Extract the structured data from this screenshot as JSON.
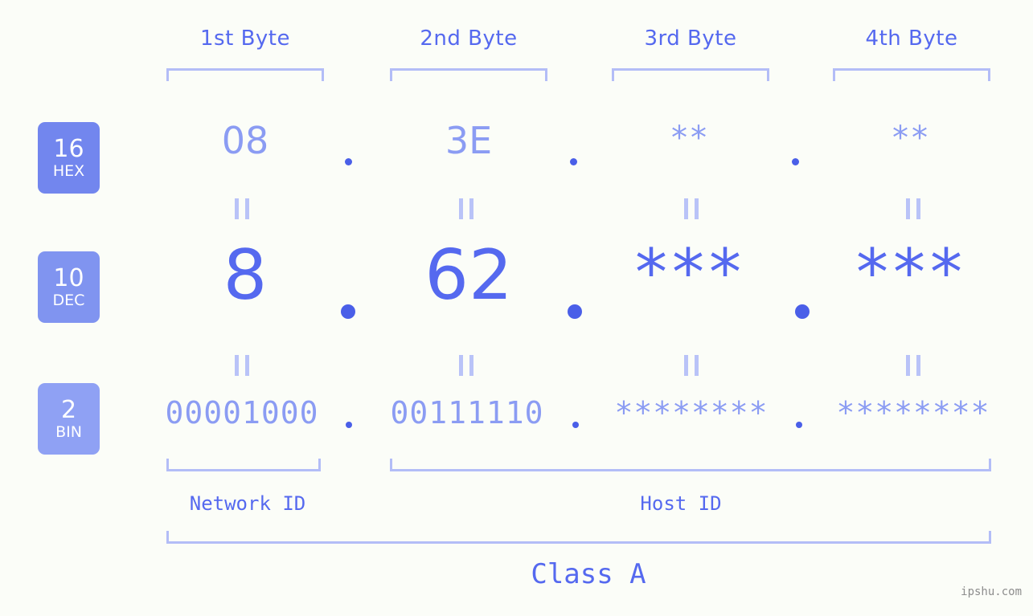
{
  "background_color": "#fbfdf8",
  "accent_color": "#5569ef",
  "accent_light_color": "#8b9cf3",
  "bracket_color": "#b3bdf7",
  "byte_headers": [
    {
      "label": "1st Byte"
    },
    {
      "label": "2nd Byte"
    },
    {
      "label": "3rd Byte"
    },
    {
      "label": "4th Byte"
    }
  ],
  "rows": [
    {
      "base": "16",
      "unit": "HEX",
      "badge_color": "#7286ee",
      "values": [
        "08",
        "3E",
        "**",
        "**"
      ]
    },
    {
      "base": "10",
      "unit": "DEC",
      "badge_color": "#8094f0",
      "values": [
        "8",
        "62",
        "***",
        "***"
      ]
    },
    {
      "base": "2",
      "unit": "BIN",
      "badge_color": "#8fa1f4",
      "values": [
        "00001000",
        "00111110",
        "********",
        "********"
      ]
    }
  ],
  "separator": ".",
  "equality_symbol": "=",
  "regions": [
    {
      "label": "Network ID"
    },
    {
      "label": "Host ID"
    }
  ],
  "class": {
    "label": "Class A"
  },
  "watermark": "ipshu.com"
}
